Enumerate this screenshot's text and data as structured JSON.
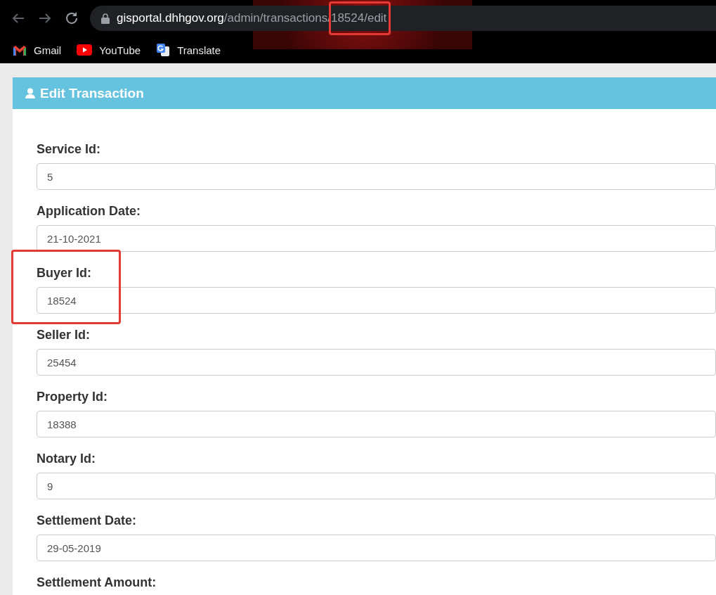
{
  "browser": {
    "url": {
      "host": "gisportal.dhhgov.org",
      "path": "/admin/transactions/",
      "tail": "18524/edit",
      "tail_highlighted": true
    },
    "bookmarks": [
      {
        "label": "Gmail",
        "kind": "gmail"
      },
      {
        "label": "YouTube",
        "kind": "youtube"
      },
      {
        "label": "Translate",
        "kind": "translate"
      }
    ]
  },
  "panel": {
    "title": "Edit Transaction",
    "fields": [
      {
        "label": "Service Id:",
        "value": "5",
        "highlighted": false
      },
      {
        "label": "Application Date:",
        "value": "21-10-2021",
        "highlighted": false
      },
      {
        "label": "Buyer Id:",
        "value": "18524",
        "highlighted": true
      },
      {
        "label": "Seller Id:",
        "value": "25454",
        "highlighted": false
      },
      {
        "label": "Property Id:",
        "value": "18388",
        "highlighted": false
      },
      {
        "label": "Notary Id:",
        "value": "9",
        "highlighted": false
      },
      {
        "label": "Settlement Date:",
        "value": "29-05-2019",
        "highlighted": false
      },
      {
        "label": "Settlement Amount:",
        "highlighted": false
      }
    ]
  }
}
